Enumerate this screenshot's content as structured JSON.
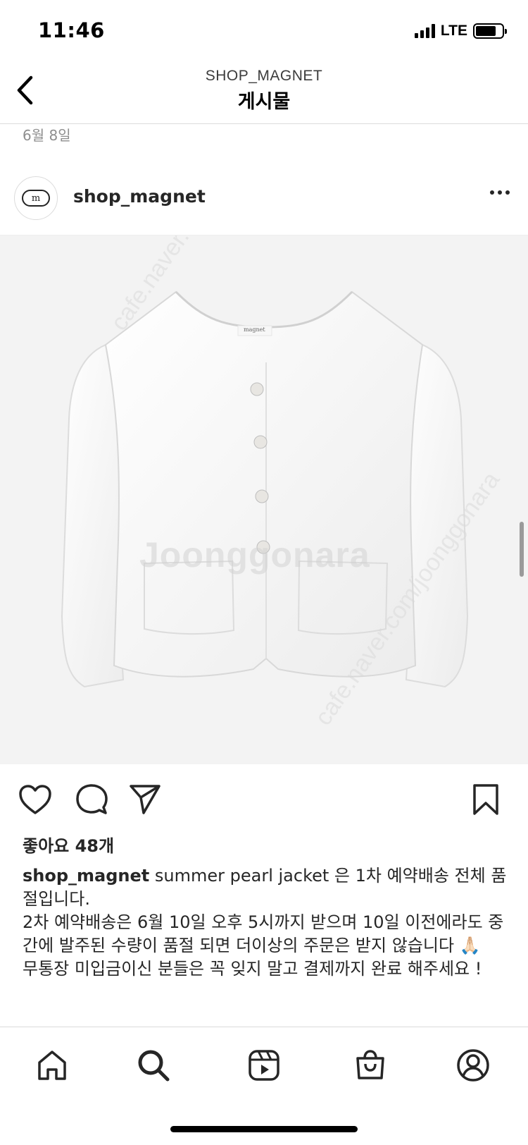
{
  "status_bar": {
    "time": "11:46",
    "network": "LTE"
  },
  "nav": {
    "subtitle": "SHOP_MAGNET",
    "title": "게시물"
  },
  "previous_post_date": "6월 8일",
  "post": {
    "username": "shop_magnet",
    "avatar_logo_text": "m",
    "image": {
      "description_icon": "white-jacket-photo",
      "label_text": "magnet",
      "watermark_main": "Joonggonara",
      "watermark_diag_1": "cafe.naver.com/joonggonara",
      "watermark_diag_2": "cafe.naver.com/joonggonara"
    },
    "likes": "좋아요 48개",
    "caption": {
      "username": "shop_magnet",
      "line1": " summer pearl jacket 은 1차 예약배송 전체 품절입니다.",
      "line2": "2차 예약배송은 6월 10일 오후 5시까지 받으며 10일 이전에라도 중간에 발주된 수량이 품절 되면 더이상의 주문은 받지 않습니다 🙏🏻",
      "line3": "무통장 미입금이신 분들은 꼭 잊지 말고 결제까지 완료 해주세요 !"
    }
  },
  "icons": {
    "back": "chevron-left-icon",
    "more": "more-horizontal-icon",
    "like": "heart-icon",
    "comment": "comment-icon",
    "share": "paper-plane-icon",
    "save": "bookmark-icon",
    "tabs": [
      "home-icon",
      "search-icon",
      "reels-icon",
      "shop-icon",
      "profile-icon"
    ]
  },
  "colors": {
    "text_primary": "#262626",
    "text_secondary": "#8e8e8e",
    "divider": "#dbdbdb",
    "image_bg": "#f3f3f3"
  }
}
